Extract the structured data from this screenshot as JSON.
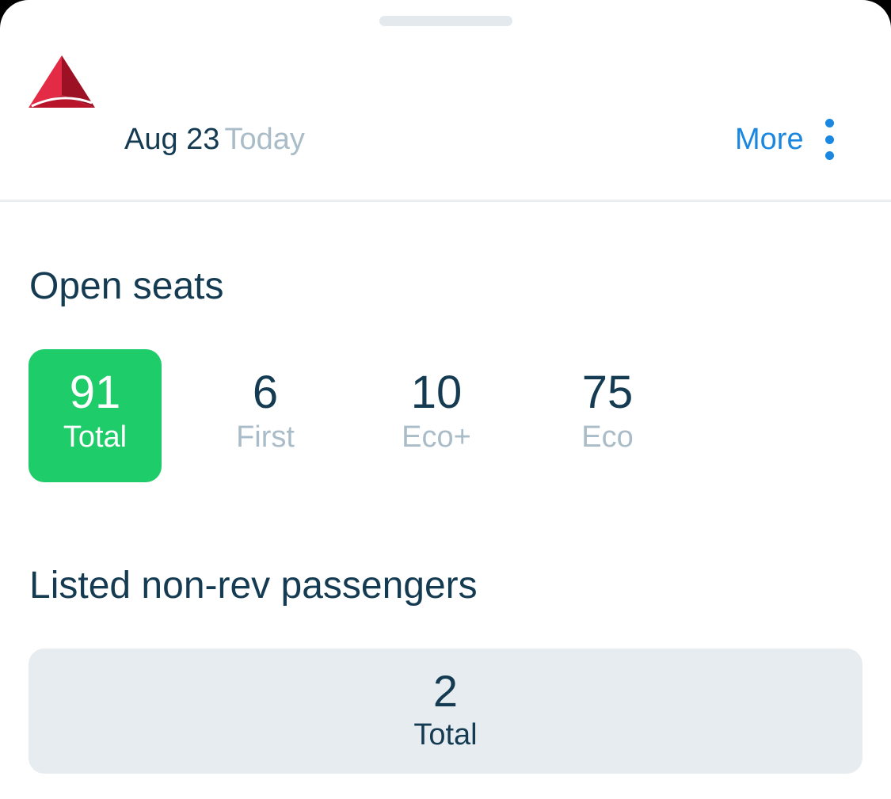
{
  "header": {
    "logo": "delta-widget-logo",
    "date": "Aug 23",
    "date_relative": "Today",
    "more_label": "More",
    "more_icon": "kebab-menu-icon"
  },
  "open_seats": {
    "title": "Open seats",
    "items": [
      {
        "value": "91",
        "label": "Total",
        "selected": true
      },
      {
        "value": "6",
        "label": "First",
        "selected": false
      },
      {
        "value": "10",
        "label": "Eco+",
        "selected": false
      },
      {
        "value": "75",
        "label": "Eco",
        "selected": false
      }
    ]
  },
  "non_rev": {
    "title": "Listed non-rev passengers",
    "total_value": "2",
    "total_label": "Total"
  },
  "colors": {
    "accent_blue": "#1a87e0",
    "selected_green": "#1ecc69",
    "text_dark": "#143b52",
    "text_muted": "#a9bcc8",
    "card_bg": "#e6ecef",
    "logo_red": "#d41f3a"
  }
}
